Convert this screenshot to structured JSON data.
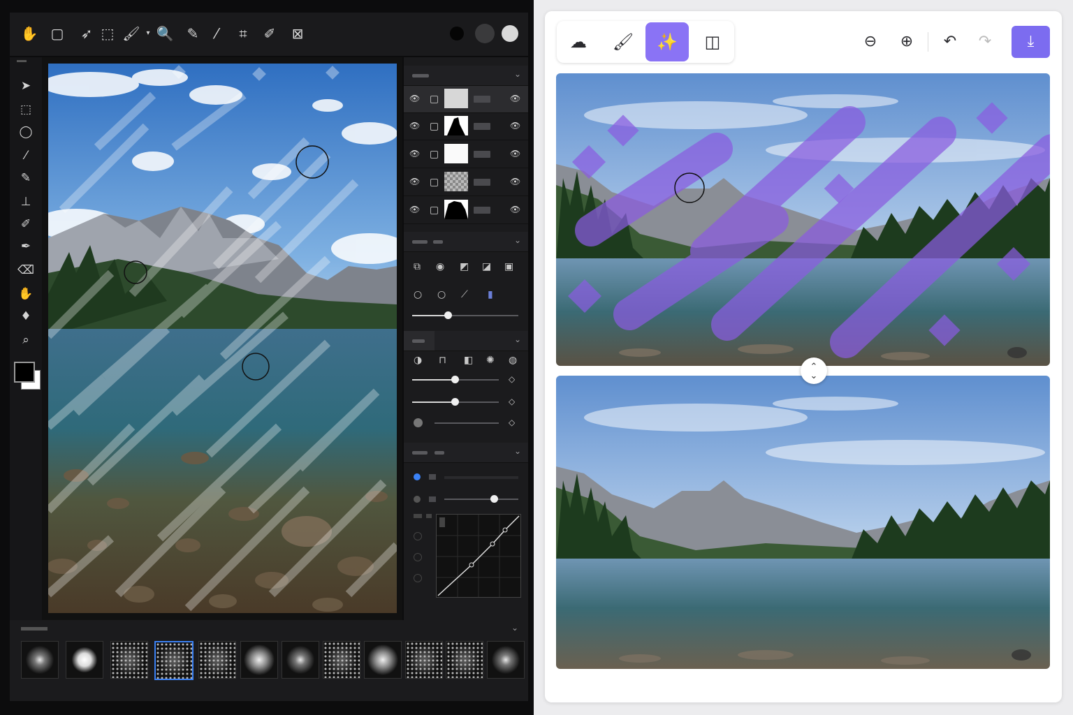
{
  "left_app": {
    "top_toolbar": {
      "tools": [
        "hand-icon",
        "lasso-icon",
        "select-arrow-icon",
        "direct-select-icon",
        "brush-icon",
        "dropdown-icon",
        "zoom-icon",
        "pen-icon",
        "eyedropper-icon",
        "crop-icon",
        "color-picker-icon",
        "transform-icon"
      ],
      "swatches": [
        "#0a0a0a",
        "#3a3a3c",
        "#d9d9d9"
      ]
    },
    "left_tools": [
      "move-icon",
      "marquee-icon",
      "lasso-icon",
      "brush-icon",
      "pencil-icon",
      "stamp-icon",
      "healing-icon",
      "pen-icon",
      "eraser-icon",
      "hand-icon",
      "dodge-icon",
      "zoom-icon"
    ],
    "foreground_color": "#000000",
    "background_color": "#ffffff",
    "brush_strokes_overlay": "white-translucent",
    "layers": [
      "gray",
      "silhouette",
      "white",
      "transparent",
      "mask"
    ],
    "brush_presets_count": 12
  },
  "right_app": {
    "toolbar": {
      "modes": [
        "cloud-upload-icon",
        "brush-icon",
        "magic-wand-icon",
        "split-view-icon"
      ],
      "active_mode": "magic-wand-icon",
      "actions": [
        "zoom-out-icon",
        "zoom-in-icon",
        "undo-icon",
        "redo-icon"
      ],
      "download": "download-icon"
    },
    "accent_color": "#7c6cf0",
    "overlay_color": "#8a5ce0",
    "handle_glyphs": {
      "up": "⌃",
      "down": "⌄"
    }
  }
}
